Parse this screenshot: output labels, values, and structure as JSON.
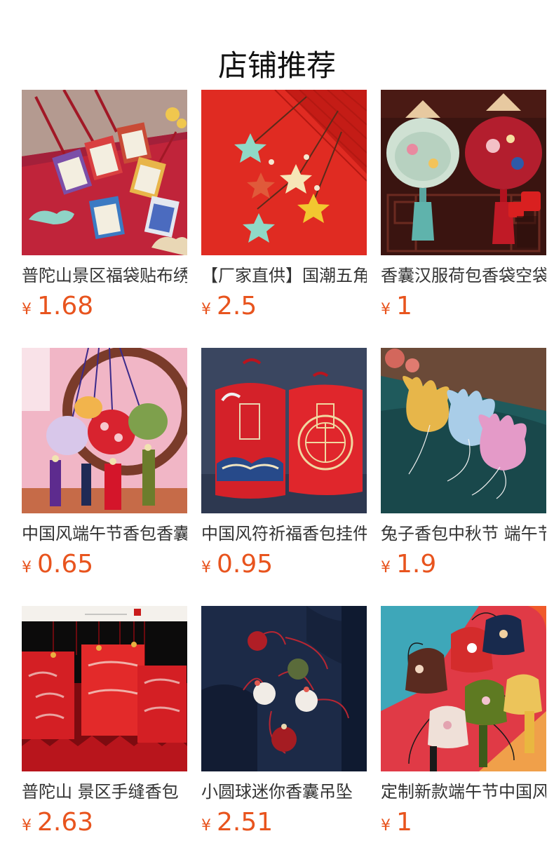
{
  "page": {
    "title": "店铺推荐"
  },
  "products": [
    {
      "name": "普陀山景区福袋贴布绣",
      "currency": "¥",
      "price": "1.68",
      "image_icon": "amulet-pouches-image"
    },
    {
      "name": "【厂家直供】国潮五角",
      "currency": "¥",
      "price": "2.5",
      "image_icon": "star-pendants-image"
    },
    {
      "name": "香囊汉服荷包香袋空袋",
      "currency": "¥",
      "price": "1",
      "image_icon": "court-sachet-image"
    },
    {
      "name": "中国风端午节香包香囊",
      "currency": "¥",
      "price": "0.65",
      "image_icon": "tassel-sachets-image"
    },
    {
      "name": "中国风符祈福香包挂件",
      "currency": "¥",
      "price": "0.95",
      "image_icon": "blessing-charms-image"
    },
    {
      "name": "兔子香包中秋节 端午节",
      "currency": "¥",
      "price": "1.9",
      "image_icon": "rabbit-sachets-image"
    },
    {
      "name": "普陀山 景区手缝香包",
      "currency": "¥",
      "price": "2.63",
      "image_icon": "red-brocade-bags-image"
    },
    {
      "name": "小圆球迷你香囊吊坠",
      "currency": "¥",
      "price": "2.51",
      "image_icon": "mini-ball-sachets-image"
    },
    {
      "name": "定制新款端午节中国风",
      "currency": "¥",
      "price": "1",
      "image_icon": "embroidered-sachets-image"
    }
  ]
}
